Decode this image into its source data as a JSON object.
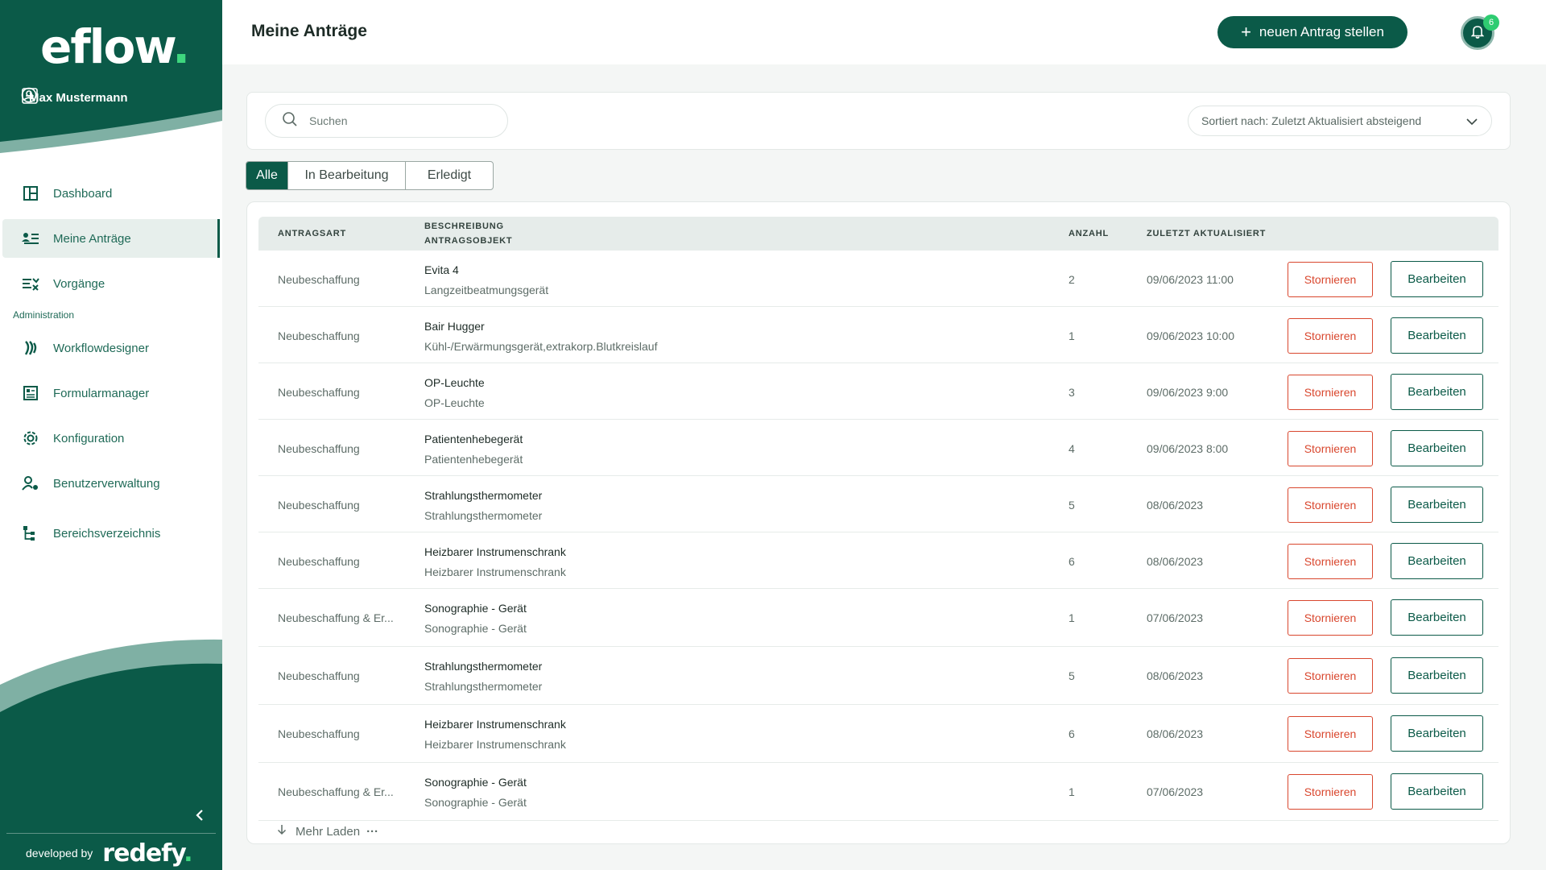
{
  "app": {
    "logo_text": "eflow",
    "logo_dot": "."
  },
  "user": {
    "name": "Max Mustermann"
  },
  "nav": {
    "items": [
      {
        "label": "Dashboard",
        "icon": "dashboard-icon"
      },
      {
        "label": "Meine Anträge",
        "icon": "list-user-icon",
        "active": true
      },
      {
        "label": "Vorgänge",
        "icon": "tasks-icon"
      }
    ],
    "section_label": "Administration",
    "admin_items": [
      {
        "label": "Workflowdesigner",
        "icon": "workflow-icon"
      },
      {
        "label": "Formularmanager",
        "icon": "form-icon"
      },
      {
        "label": "Konfiguration",
        "icon": "gear-icon"
      },
      {
        "label": "Benutzerverwaltung",
        "icon": "user-gear-icon"
      },
      {
        "label": "Bereichsverzeichnis",
        "icon": "hierarchy-icon"
      }
    ]
  },
  "footer": {
    "developed_by": "developed by",
    "brand": "redefy",
    "brand_dot": "."
  },
  "header": {
    "title": "Meine Anträge",
    "new_button": "neuen Antrag stellen",
    "notification_count": "6"
  },
  "search": {
    "placeholder": "Suchen",
    "sort_label": "Sortiert nach: Zuletzt Aktualisiert absteigend"
  },
  "tabs": [
    {
      "label": "Alle",
      "active": true
    },
    {
      "label": "In Bearbeitung",
      "active": false
    },
    {
      "label": "Erledigt",
      "active": false
    }
  ],
  "table": {
    "headers": {
      "type": "ANTRAGSART",
      "desc_line1": "BESCHREIBUNG",
      "desc_line2": "ANTRAGSOBJEKT",
      "qty": "ANZAHL",
      "updated": "ZULETZT AKTUALISIERT"
    },
    "cancel_label": "Stornieren",
    "edit_label": "Bearbeiten",
    "rows": [
      {
        "type": "Neubeschaffung",
        "title": "Evita 4",
        "sub": "Langzeitbeatmungsgerät",
        "qty": "2",
        "date": "09/06/2023 11:00"
      },
      {
        "type": "Neubeschaffung",
        "title": "Bair Hugger",
        "sub": "Kühl-/Erwärmungsgerät,extrakorp.Blutkreislauf",
        "qty": "1",
        "date": "09/06/2023 10:00"
      },
      {
        "type": "Neubeschaffung",
        "title": "OP-Leuchte",
        "sub": "OP-Leuchte",
        "qty": "3",
        "date": "09/06/2023 9:00"
      },
      {
        "type": "Neubeschaffung",
        "title": "Patientenhebegerät",
        "sub": "Patientenhebegerät",
        "qty": "4",
        "date": "09/06/2023 8:00"
      },
      {
        "type": "Neubeschaffung",
        "title": "Strahlungsthermometer",
        "sub": "Strahlungsthermometer",
        "qty": "5",
        "date": "08/06/2023"
      },
      {
        "type": "Neubeschaffung",
        "title": "Heizbarer Instrumenschrank",
        "sub": "Heizbarer Instrumenschrank",
        "qty": "6",
        "date": "08/06/2023"
      },
      {
        "type": "Neubeschaffung  & Er...",
        "title": "Sonographie - Gerät",
        "sub": "Sonographie - Gerät",
        "qty": "1",
        "date": "07/06/2023"
      },
      {
        "type": "Neubeschaffung",
        "title": "Strahlungsthermometer",
        "sub": "Strahlungsthermometer",
        "qty": "5",
        "date": "08/06/2023"
      },
      {
        "type": "Neubeschaffung",
        "title": "Heizbarer Instrumenschrank",
        "sub": "Heizbarer Instrumenschrank",
        "qty": "6",
        "date": "08/06/2023"
      },
      {
        "type": "Neubeschaffung  & Er...",
        "title": "Sonographie - Gerät",
        "sub": "Sonographie - Gerät",
        "qty": "1",
        "date": "07/06/2023"
      }
    ],
    "load_more": "Mehr Laden"
  },
  "colors": {
    "brand": "#0b5a48",
    "accent_green": "#3ed67e",
    "danger": "#d9472e"
  }
}
